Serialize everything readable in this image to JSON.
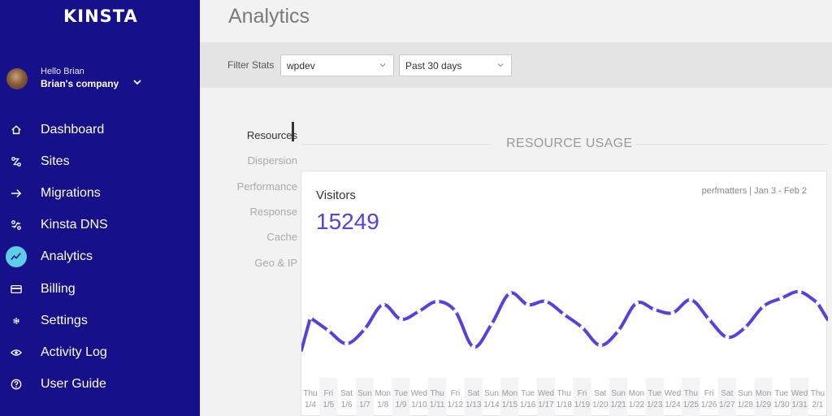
{
  "app": {
    "logo": "KINSTA",
    "title": "Analytics"
  },
  "user": {
    "greeting": "Hello Brian",
    "company": "Brian's company"
  },
  "nav": [
    {
      "label": "Dashboard",
      "icon": "home-icon"
    },
    {
      "label": "Sites",
      "icon": "sites-icon"
    },
    {
      "label": "Migrations",
      "icon": "migrations-icon"
    },
    {
      "label": "Kinsta DNS",
      "icon": "dns-icon"
    },
    {
      "label": "Analytics",
      "icon": "analytics-icon",
      "active": true
    },
    {
      "label": "Billing",
      "icon": "billing-icon"
    },
    {
      "label": "Settings",
      "icon": "gear-icon"
    },
    {
      "label": "Activity Log",
      "icon": "eye-icon"
    },
    {
      "label": "User Guide",
      "icon": "help-icon"
    }
  ],
  "filters": {
    "label": "Filter Stats",
    "site": "wpdev",
    "range": "Past 30 days"
  },
  "submenu": [
    "Resources",
    "Dispersion",
    "Performance",
    "Response",
    "Cache",
    "Geo & IP"
  ],
  "section": {
    "title": "RESOURCE USAGE"
  },
  "card": {
    "title": "Visitors",
    "total": "15249",
    "meta": "perfmatters | Jan 3 - Feb 2"
  },
  "colors": {
    "sidebar": "#16108a",
    "accent": "#5a3fe0",
    "active_icon_bg": "#5ccfe6"
  },
  "chart_data": {
    "type": "line",
    "x_days": [
      "Thu",
      "Fri",
      "Sat",
      "Sun",
      "Mon",
      "Tue",
      "Wed",
      "Thu",
      "Fri",
      "Sat",
      "Sun",
      "Mon",
      "Tue",
      "Wed",
      "Thu",
      "Fri",
      "Sat",
      "Sun",
      "Mon",
      "Tue",
      "Wed",
      "Thu",
      "Fri",
      "Sat",
      "Sun",
      "Mon",
      "Tue",
      "Wed",
      "Thu"
    ],
    "x_dates": [
      "1/4",
      "1/5",
      "1/6",
      "1/7",
      "1/8",
      "1/9",
      "1/10",
      "1/11",
      "1/12",
      "1/13",
      "1/14",
      "1/15",
      "1/16",
      "1/17",
      "1/18",
      "1/19",
      "1/20",
      "1/21",
      "1/22",
      "1/23",
      "1/24",
      "1/25",
      "1/26",
      "1/27",
      "1/28",
      "1/29",
      "1/30",
      "1/31",
      "2/1"
    ],
    "series": [
      {
        "values": [
          600,
          520,
          440,
          530,
          680,
          590,
          640,
          700,
          640,
          420,
          560,
          750,
          680,
          700,
          620,
          540,
          430,
          520,
          690,
          650,
          630,
          710,
          590,
          480,
          540,
          670,
          720,
          760,
          690
        ]
      }
    ],
    "ylim": [
      0,
      1000
    ]
  }
}
